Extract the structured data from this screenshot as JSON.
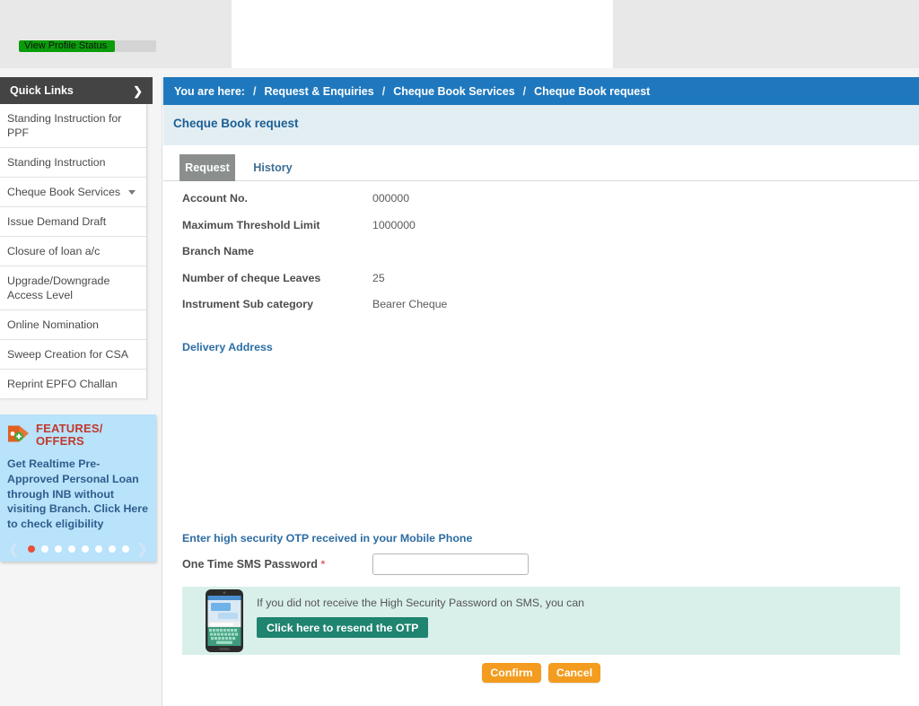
{
  "profile": {
    "status_label": "View Profile Status",
    "progress_percent": 70,
    "fill_color": "#0a9c0a"
  },
  "breadcrumb": {
    "prefix": "You are here:",
    "separator": "/",
    "items": [
      "Request & Enquiries",
      "Cheque Book Services",
      "Cheque Book request"
    ],
    "background": "#1f78bd"
  },
  "sidebar": {
    "header": "Quick Links",
    "header_icon": "chevron-right-icon",
    "items": [
      {
        "label": "Standing Instruction for PPF",
        "has_caret": false
      },
      {
        "label": "Standing Instruction",
        "has_caret": false
      },
      {
        "label": "Cheque Book Services",
        "has_caret": true
      },
      {
        "label": "Issue Demand Draft",
        "has_caret": false
      },
      {
        "label": "Closure of loan a/c",
        "has_caret": false
      },
      {
        "label": "Upgrade/Downgrade Access Level",
        "has_caret": false
      },
      {
        "label": "Online Nomination",
        "has_caret": false
      },
      {
        "label": "Sweep Creation for CSA",
        "has_caret": false
      },
      {
        "label": "Reprint EPFO Challan",
        "has_caret": false
      }
    ]
  },
  "promo": {
    "icon": "price-tag-icon",
    "title": "FEATURES/ OFFERS",
    "body": "Get Realtime Pre-Approved Personal Loan through INB without visiting Branch. Click Here to check eligibility",
    "prev_icon": "chevron-left-icon",
    "next_icon": "chevron-right-icon",
    "dot_count": 8,
    "active_dot": 0,
    "background": "#b9e2fb",
    "title_color": "#c0392b"
  },
  "main": {
    "page_title": "Cheque Book request",
    "tabs": [
      {
        "label": "Request",
        "active": true
      },
      {
        "label": "History",
        "active": false
      }
    ],
    "form_rows": [
      {
        "label": "Account No.",
        "value": "000000"
      },
      {
        "label": "Maximum Threshold Limit",
        "value": "1000000"
      },
      {
        "label": "Branch Name",
        "value": ""
      },
      {
        "label": "Number of cheque Leaves",
        "value": "25"
      },
      {
        "label": "Instrument Sub category",
        "value": "Bearer Cheque"
      }
    ],
    "delivery_address_link": "Delivery Address"
  },
  "otp": {
    "heading": "Enter high security OTP received in your Mobile Phone",
    "field_label": "One Time SMS Password",
    "required_marker": "*",
    "field_value": "",
    "field_placeholder": "",
    "resend_note": "If you did not receive the High Security Password on SMS, you can",
    "resend_button": "Click here to resend the OTP",
    "phone_icon": "mobile-phone-sms-icon",
    "panel_background": "#d9f0ea",
    "button_color": "#1f8470"
  },
  "actions": {
    "confirm_label": "Confirm",
    "cancel_label": "Cancel",
    "button_color": "#f39c1f"
  }
}
